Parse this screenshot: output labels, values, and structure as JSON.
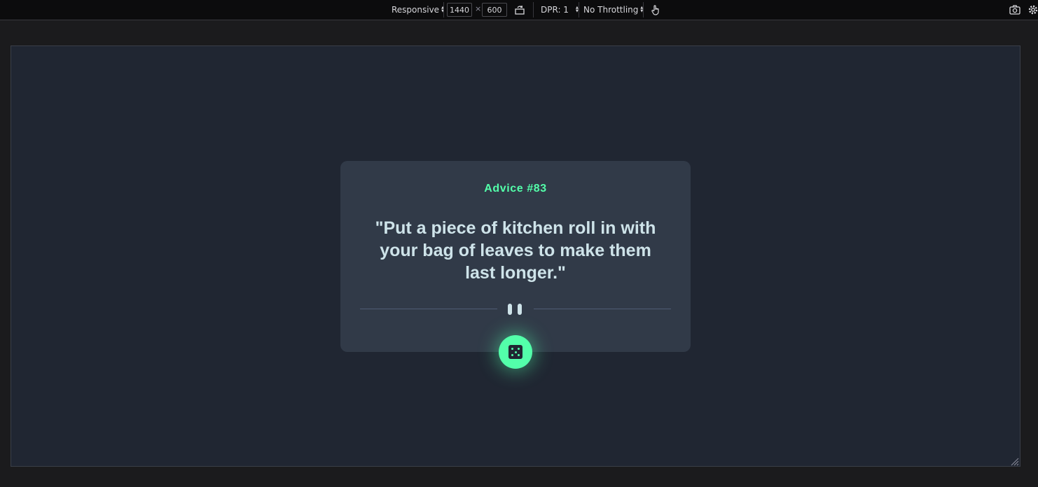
{
  "devtools": {
    "device_label": "Responsive",
    "width_value": "1440",
    "times_sign": "×",
    "height_value": "600",
    "dpr_label": "DPR: 1",
    "throttling_label": "No Throttling",
    "icons": {
      "rotate": "rotate-icon",
      "touch": "touch-icon",
      "screenshot": "camera-icon",
      "settings": "gear-icon"
    }
  },
  "advice": {
    "title": "Advice #83",
    "quote": "\"Put a piece of kitchen roll in with your bag of leaves to make them last longer.\"",
    "button_icon": "dice-icon"
  },
  "colors": {
    "accent": "#53ffaa",
    "card": "#313a48",
    "page_background": "#202632",
    "quote_text": "#cee3e9"
  }
}
